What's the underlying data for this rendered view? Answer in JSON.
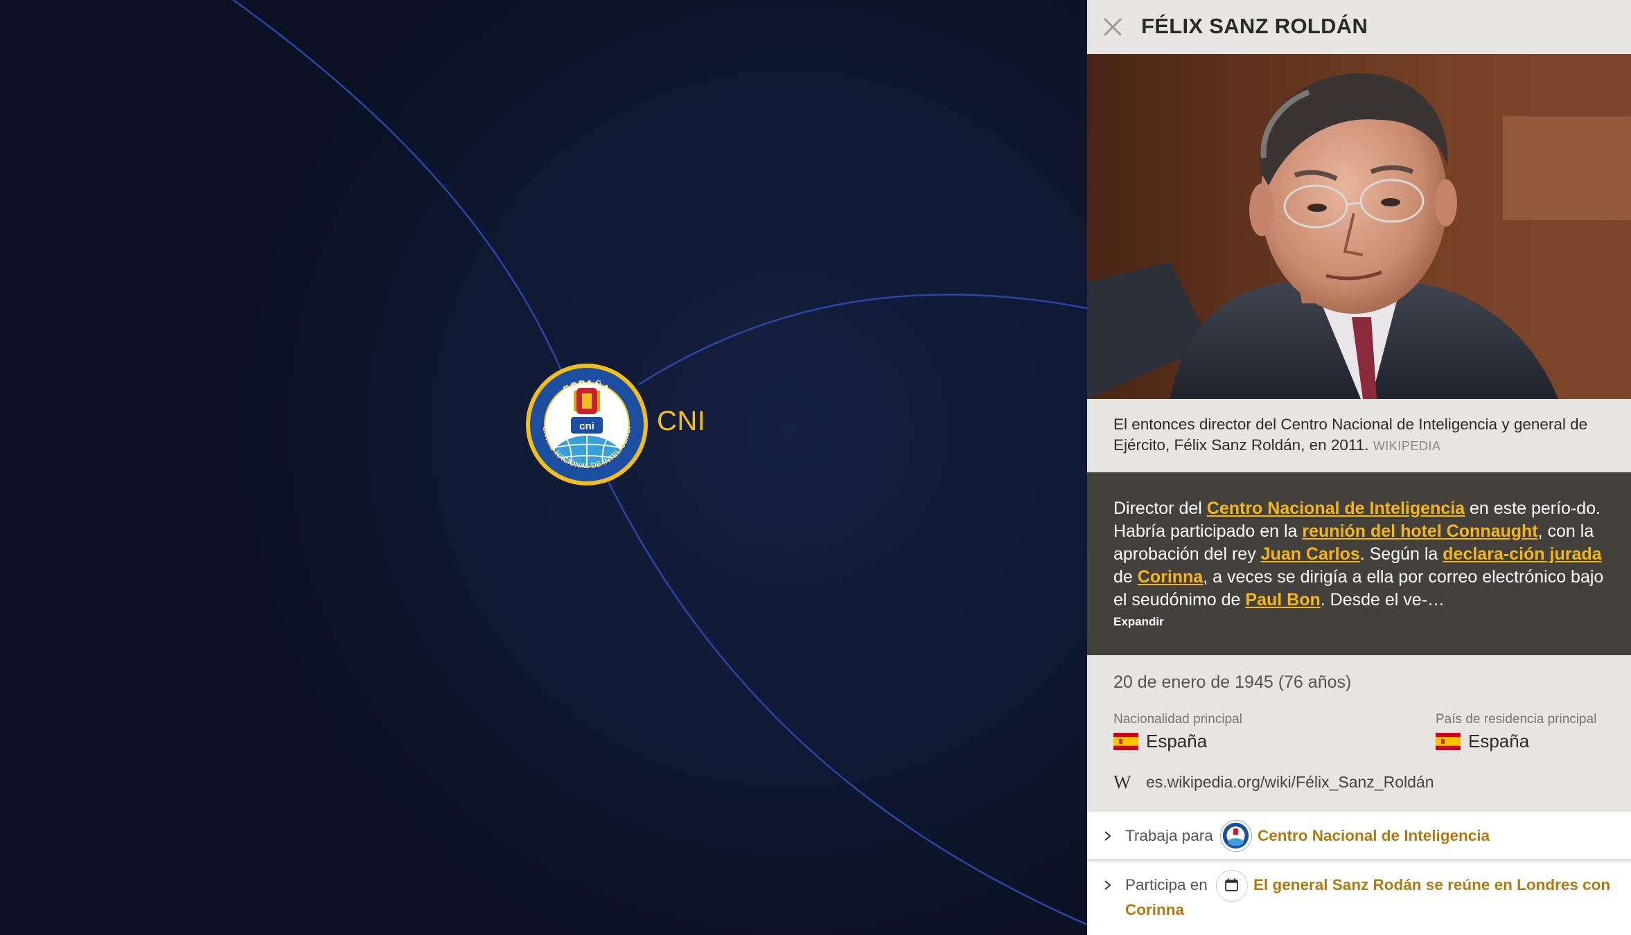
{
  "graph": {
    "node": {
      "label": "CNI",
      "logo_name": "cni-logo"
    },
    "edge_color": "#2748a8"
  },
  "panel": {
    "title": "FÉLIX SANZ ROLDÁN",
    "close_icon": "close-icon",
    "caption": {
      "text": "El entonces director del Centro Nacional de Inteligencia y general de Ejército, Félix Sanz Roldán, en 2011.",
      "source": "WIKIPEDIA"
    },
    "description": {
      "t1": "Director del ",
      "l1": "Centro Nacional de Inteligencia",
      "t2": " en este perío-do. Habría participado en la ",
      "l2": "reunión del hotel Connaught",
      "t3": ", con la aprobación del rey ",
      "l3": "Juan Carlos",
      "t4": ". Según la ",
      "l4": "declara-ción jurada",
      "t5": " de ",
      "l5": "Corinna",
      "t6": ", a veces se dirigía a ella por correo electrónico bajo el seudónimo de ",
      "l6": "Paul Bon",
      "t7": ". Desde el ve-…",
      "expand": "Expandir"
    },
    "birth": "20 de enero de 1945 (76 años)",
    "nationality": {
      "label": "Nacionalidad principal",
      "value": "España",
      "flag_icon": "spain-flag-icon"
    },
    "residence": {
      "label": "País de residencia principal",
      "value": "España",
      "flag_icon": "spain-flag-icon"
    },
    "wiki": {
      "icon": "W",
      "url": "es.wikipedia.org/wiki/Félix_Sanz_Roldán"
    },
    "relations": [
      {
        "verb": "Trabaja para",
        "target": "Centro Nacional de Inteligencia",
        "icon": "cni-logo"
      },
      {
        "verb": "Participa en",
        "target_line1": "El general Sanz Rodán se reúne en Londres con",
        "target_line2": "Corinna",
        "icon": "calendar-icon"
      }
    ],
    "colors": {
      "link": "#f5b619",
      "relation_link": "#b07a10",
      "description_bg": "#44413c"
    }
  }
}
